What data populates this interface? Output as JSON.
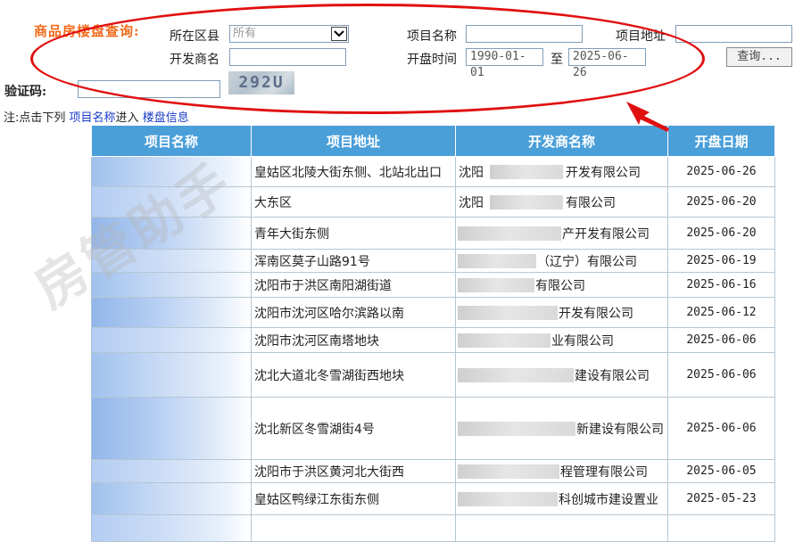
{
  "search": {
    "title": "商品房楼盘查询:",
    "district_label": "所在区县",
    "district_value": "所有",
    "project_name_label": "项目名称",
    "project_name_value": "",
    "project_address_label": "项目地址",
    "project_address_value": "",
    "developer_label": "开发商名",
    "developer_value": "",
    "open_time_label": "开盘时间",
    "date_from": "1990-01-01",
    "date_to_label": "至",
    "date_to": "2025-06-26",
    "query_button": "查询...",
    "captcha_label": "验证码:",
    "captcha_value": "",
    "captcha_image_text": "292U"
  },
  "note": {
    "prefix": "注:点击下列",
    "link1": "项目名称",
    "middle": "进入",
    "link2": "楼盘信息"
  },
  "table": {
    "headers": [
      "项目名称",
      "项目地址",
      "开发商名称",
      "开盘日期"
    ],
    "rows": [
      {
        "address": "皇姑区北陵大街东侧、北站北出口",
        "developer": "开发有限公司",
        "dev_prefix": "沈阳",
        "date": "2025-06-26"
      },
      {
        "address": "大东区",
        "developer": "有限公司",
        "dev_prefix": "沈阳",
        "date": "2025-06-20"
      },
      {
        "address": "青年大街东侧",
        "developer": "产开发有限公司",
        "dev_prefix": "",
        "date": "2025-06-20"
      },
      {
        "address": "浑南区莫子山路91号",
        "developer": "（辽宁）有限公司",
        "dev_prefix": "",
        "date": "2025-06-19"
      },
      {
        "address": "沈阳市于洪区南阳湖街道",
        "developer": "有限公司",
        "dev_prefix": "",
        "date": "2025-06-16"
      },
      {
        "address": "沈阳市沈河区哈尔滨路以南",
        "developer": "开发有限公司",
        "dev_prefix": "",
        "date": "2025-06-12"
      },
      {
        "address": "沈阳市沈河区南塔地块",
        "developer": "业有限公司",
        "dev_prefix": "",
        "date": "2025-06-06"
      },
      {
        "address": "沈北大道北冬雪湖街西地块",
        "developer": "建设有限公司",
        "dev_prefix": "",
        "date": "2025-06-06"
      },
      {
        "address": "沈北新区冬雪湖街4号",
        "developer": "新建设有限公司",
        "dev_prefix": "",
        "date": "2025-06-06"
      },
      {
        "address": "沈阳市于洪区黄河北大街西",
        "developer": "程管理有限公司",
        "dev_prefix": "",
        "date": "2025-06-05"
      },
      {
        "address": "皇姑区鸭绿江东街东侧",
        "developer": "科创城市建设置业",
        "dev_prefix": "",
        "date": "2025-05-23"
      },
      {
        "address": "",
        "developer": "",
        "dev_prefix": "",
        "date": ""
      }
    ]
  },
  "watermark": "房管助手",
  "colors": {
    "title": "#f26b1d",
    "header_bg": "#4a9fd9",
    "annotation_red": "#e01010",
    "link": "#1a3cc8"
  }
}
